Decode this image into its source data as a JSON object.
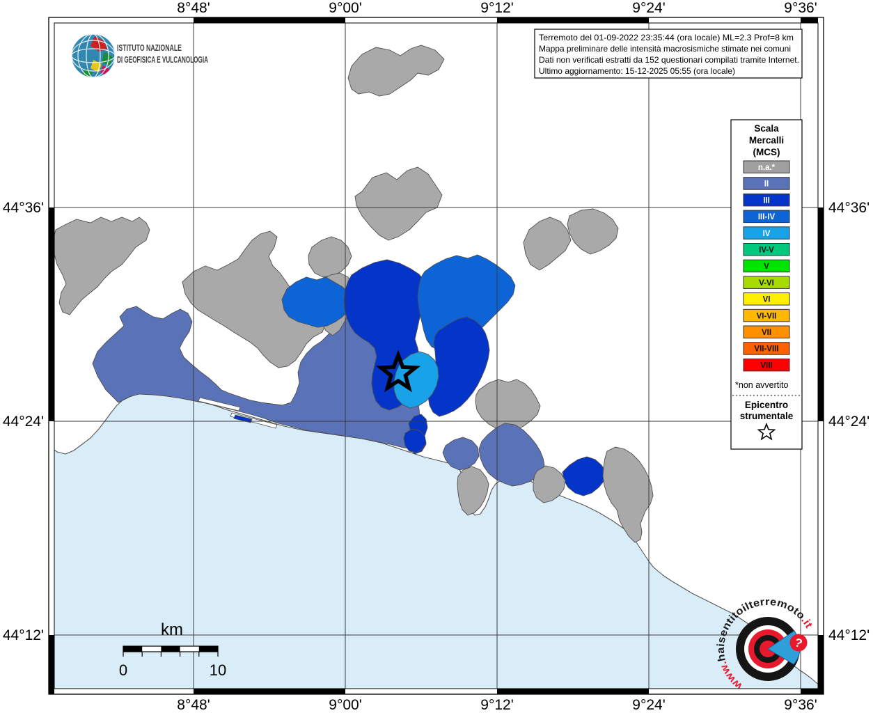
{
  "branding": {
    "institute_line1": "ISTITUTO NAZIONALE",
    "institute_line2": "DI GEOFISICA E VULCANOLOGIA"
  },
  "info_box": {
    "line1": "Terremoto del 01-09-2022 23:35:44 (ora locale) ML=2.3 Prof=8 km",
    "line2": "Mappa preliminare delle intensità macrosismiche stimate nei comuni",
    "line3": "Dati non verificati estratti da 152 questionari compilati tramite Internet.",
    "line4": "Ultimo aggiornamento: 15-12-2025 05:55 (ora locale)"
  },
  "axes": {
    "top": [
      "8°48'",
      "9°00'",
      "9°12'",
      "9°24'",
      "9°36'"
    ],
    "bottom": [
      "8°48'",
      "9°00'",
      "9°12'",
      "9°24'",
      "9°36'"
    ],
    "left": [
      "44°36'",
      "44°24'",
      "44°12'"
    ],
    "right": [
      "44°36'",
      "44°24'",
      "44°12'"
    ]
  },
  "legend": {
    "title": [
      "Scala",
      "Mercalli",
      "(MCS)"
    ],
    "items": [
      {
        "label": "n.a.*",
        "color": "#A0A0A0",
        "text_color": "#FFFFFF"
      },
      {
        "label": "II",
        "color": "#5A72B8",
        "text_color": "#FFFFFF"
      },
      {
        "label": "III",
        "color": "#0434C8",
        "text_color": "#FFFFFF"
      },
      {
        "label": "III-IV",
        "color": "#0C64D6",
        "text_color": "#FFFFFF"
      },
      {
        "label": "IV",
        "color": "#18A2E8",
        "text_color": "#FFFFFF"
      },
      {
        "label": "IV-V",
        "color": "#00C87D",
        "text_color": "#111111"
      },
      {
        "label": "V",
        "color": "#00E400",
        "text_color": "#111111"
      },
      {
        "label": "V-VI",
        "color": "#A8DC00",
        "text_color": "#111111"
      },
      {
        "label": "VI",
        "color": "#FFF000",
        "text_color": "#111111"
      },
      {
        "label": "VI-VII",
        "color": "#FFB900",
        "text_color": "#111111"
      },
      {
        "label": "VII",
        "color": "#FF9100",
        "text_color": "#111111"
      },
      {
        "label": "VII-VIII",
        "color": "#FF6000",
        "text_color": "#111111"
      },
      {
        "label": "VIII",
        "color": "#FF0000",
        "text_color": "#111111"
      }
    ],
    "footnote": "*non avvertito",
    "epicenter_line1": "Epicentro",
    "epicenter_line2": "strumentale"
  },
  "scale_bar": {
    "unit": "km",
    "start": "0",
    "end": "10"
  },
  "watermark": {
    "prefix": "www.",
    "main": "haisentitoilterremoto",
    "suffix": ".it",
    "question": "?"
  },
  "palette": {
    "na": "#A9A9A9",
    "II": "#5A72B8",
    "III": "#0434C8",
    "III_IV": "#0C64D6",
    "IV": "#18A2E8",
    "sea": "#D9EDF9",
    "land": "#FFFFFF",
    "boundary": "#4F4F4F"
  }
}
